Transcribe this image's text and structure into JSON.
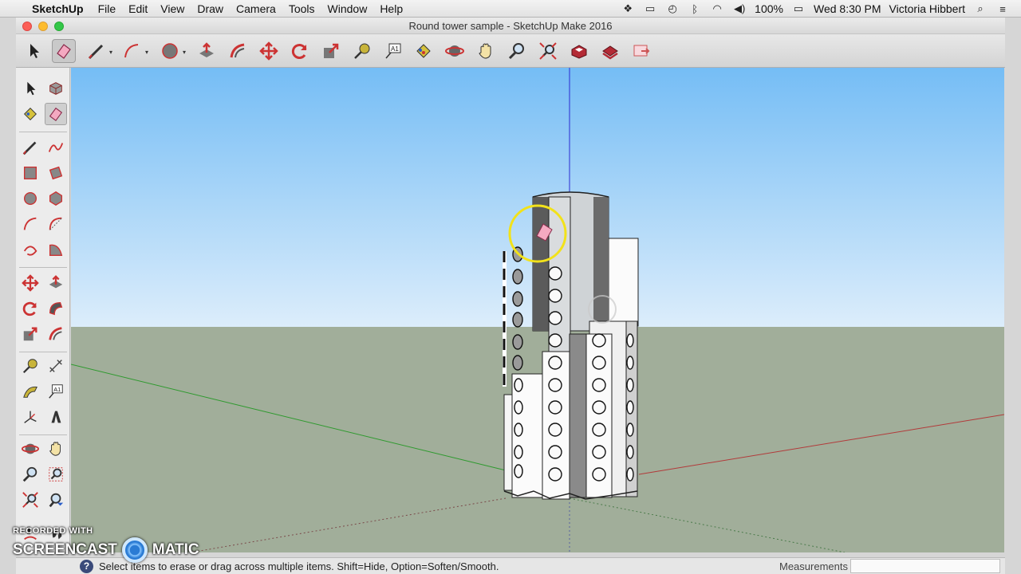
{
  "menubar": {
    "app_name": "SketchUp",
    "items": [
      "File",
      "Edit",
      "View",
      "Draw",
      "Camera",
      "Tools",
      "Window",
      "Help"
    ],
    "battery": "100%",
    "clock": "Wed 8:30 PM",
    "user": "Victoria Hibbert"
  },
  "window": {
    "title": "Round tower sample - SketchUp Make 2016"
  },
  "toolbar": {
    "tools": [
      "select-tool",
      "eraser-tool",
      "line-tool",
      "arc-tool",
      "shapes-tool",
      "push-pull-tool",
      "offset-tool",
      "move-tool",
      "rotate-tool",
      "scale-tool",
      "tape-measure-tool",
      "text-tool",
      "paint-bucket-tool",
      "orbit-tool",
      "pan-tool",
      "zoom-tool",
      "zoom-extents-tool",
      "3d-warehouse-tool",
      "extension-warehouse-tool",
      "layout-tool"
    ]
  },
  "palette": {
    "tools": [
      "select",
      "component",
      "paint-bucket",
      "eraser",
      "line",
      "freehand",
      "rectangle",
      "rotated-rectangle",
      "circle",
      "polygon",
      "arc",
      "two-point-arc",
      "three-point-arc",
      "pie",
      "move",
      "push-pull",
      "rotate",
      "follow-me",
      "scale",
      "offset",
      "tape-measure",
      "dimension",
      "protractor",
      "text",
      "axes",
      "3d-text",
      "orbit",
      "pan",
      "zoom",
      "zoom-window",
      "zoom-extents",
      "previous-view",
      "position-camera",
      "walk"
    ]
  },
  "status": {
    "message": "Select items to erase or drag across multiple items. Shift=Hide, Option=Soften/Smooth.",
    "measurements_label": "Measurements",
    "measurements_value": ""
  },
  "watermark": {
    "line1": "RECORDED WITH",
    "line2a": "SCREENCAST",
    "line2b": "MATIC"
  },
  "colors": {
    "sky_top": "#79bff5",
    "sky_bottom": "#dbeefb",
    "ground": "#9fae98",
    "green_axis": "#2f9a2f",
    "red_axis": "#b23a3a",
    "blue_axis": "#2a2ad0",
    "cursor_ring": "#f2e21a"
  }
}
